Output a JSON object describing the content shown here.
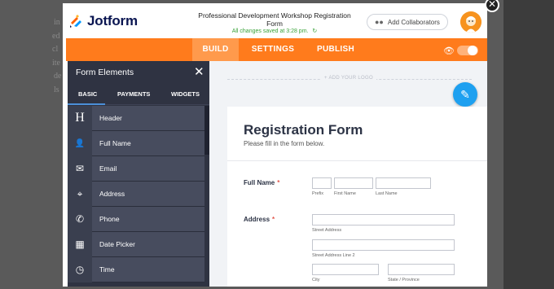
{
  "backdrop": {
    "fragments": [
      {
        "text": "in"
      },
      {
        "text": "ed"
      },
      {
        "text": "cl"
      },
      {
        "text": "ite"
      },
      {
        "text": "de"
      },
      {
        "text": "ls"
      }
    ]
  },
  "modal": {
    "close_glyph": "✕"
  },
  "header": {
    "brand": "Jotform",
    "form_title": "Professional Development Workshop Registration Form",
    "saved_status": "All changes saved at 3:28 pm.",
    "collaborators_label": "Add Collaborators",
    "colors": {
      "brand_navy": "#0a1551",
      "accent": "#ff7b1c"
    }
  },
  "nav": {
    "tabs": [
      {
        "label": "BUILD",
        "active": true
      },
      {
        "label": "SETTINGS",
        "active": false
      },
      {
        "label": "PUBLISH",
        "active": false
      }
    ],
    "preview_toggle": "off"
  },
  "panel": {
    "title": "Form Elements",
    "close_glyph": "✕",
    "tabs": [
      {
        "label": "BASIC",
        "active": true
      },
      {
        "label": "PAYMENTS",
        "active": false
      },
      {
        "label": "WIDGETS",
        "active": false
      }
    ],
    "elements": [
      {
        "label": "Header",
        "icon": "heading-icon",
        "glyph": "H"
      },
      {
        "label": "Full Name",
        "icon": "person-icon",
        "glyph": "👤"
      },
      {
        "label": "Email",
        "icon": "envelope-icon",
        "glyph": "✉"
      },
      {
        "label": "Address",
        "icon": "map-pin-icon",
        "glyph": "⌖"
      },
      {
        "label": "Phone",
        "icon": "phone-icon",
        "glyph": "✆"
      },
      {
        "label": "Date Picker",
        "icon": "calendar-icon",
        "glyph": "▦"
      },
      {
        "label": "Time",
        "icon": "clock-icon",
        "glyph": "◷"
      }
    ]
  },
  "canvas": {
    "add_logo": "+ ADD YOUR LOGO",
    "form": {
      "heading": "Registration Form",
      "subheading": "Please fill in the form below.",
      "full_name": {
        "label": "Full Name",
        "required_mark": "*",
        "sublabels": [
          "Prefix",
          "First Name",
          "Last Name"
        ]
      },
      "address": {
        "label": "Address",
        "required_mark": "*",
        "sublabels": [
          "Street Address",
          "Street Address Line 2",
          "City",
          "State / Province"
        ]
      }
    }
  }
}
